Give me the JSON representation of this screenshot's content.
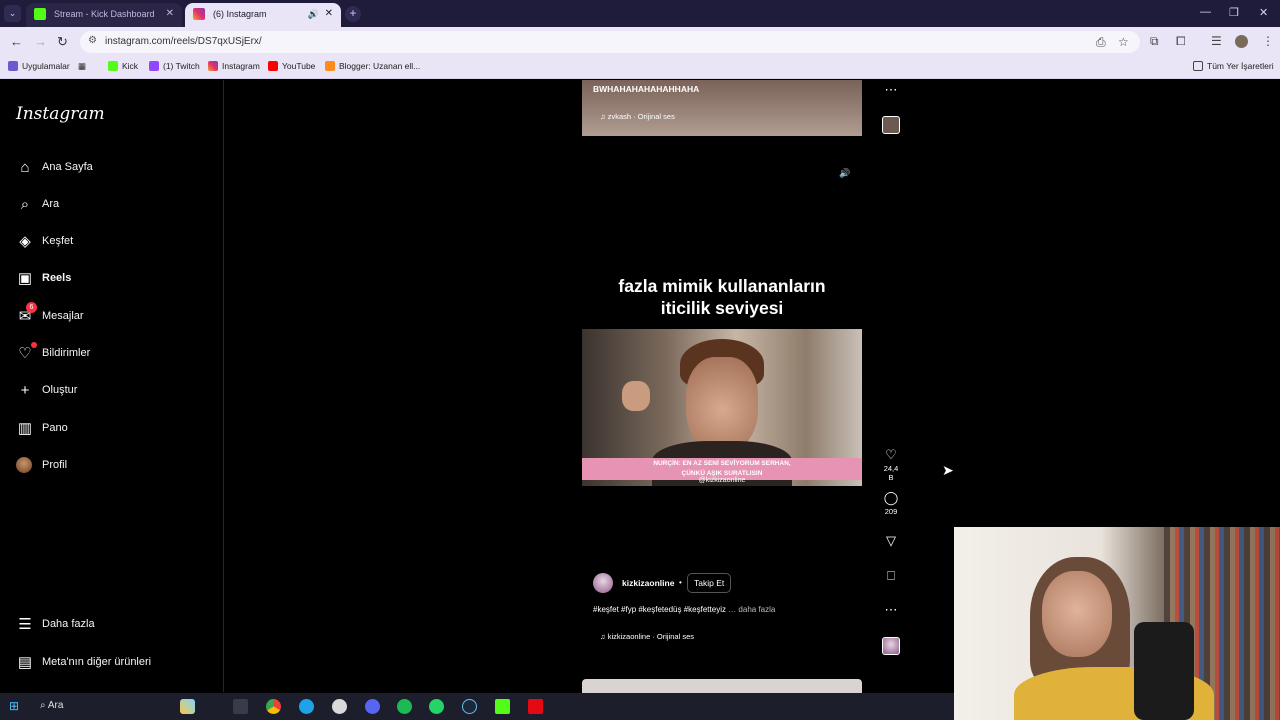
{
  "browser": {
    "tabs": [
      {
        "title": "Stream - Kick Dashboard",
        "active": false
      },
      {
        "title": "(6) Instagram",
        "active": true
      }
    ],
    "url": "instagram.com/reels/DS7qxUSjErx/",
    "bookmarks": [
      "Uygulamalar",
      "Kick",
      "(1) Twitch",
      "Instagram",
      "YouTube",
      "Blogger: Uzanan ell...",
      "Tüm Yer İşaretleri"
    ]
  },
  "sidebar": {
    "logo": "Instagram",
    "items": [
      {
        "label": "Ana Sayfa",
        "icon": "home-icon"
      },
      {
        "label": "Ara",
        "icon": "search-icon"
      },
      {
        "label": "Keşfet",
        "icon": "compass-icon"
      },
      {
        "label": "Reels",
        "icon": "reels-icon"
      },
      {
        "label": "Mesajlar",
        "icon": "messenger-icon",
        "badge": "6"
      },
      {
        "label": "Bildirimler",
        "icon": "heart-icon"
      },
      {
        "label": "Oluştur",
        "icon": "plus-icon"
      },
      {
        "label": "Pano",
        "icon": "dashboard-icon"
      },
      {
        "label": "Profil",
        "icon": "avatar"
      }
    ],
    "bottom": [
      {
        "label": "Daha fazla",
        "icon": "menu-icon"
      },
      {
        "label": "Meta'nın diğer ürünleri",
        "icon": "meta-icon"
      }
    ]
  },
  "prev_reel": {
    "caption": "BWHAHAHAHAHAHHAHA",
    "audio": "zvkash · Orijinal ses"
  },
  "reel": {
    "caption_line1": "fazla mimik kullananların",
    "caption_line2": "iticilik seviyesi",
    "subtitle_line1": "NURÇİN: EN AZ SENİ SEVİYORUM SERHAN,",
    "subtitle_line2": "ÇÜNKÜ AŞIK SURATLISIN",
    "watermark": "@kizkizaonline",
    "owner": "kizkizaonline",
    "follow_label": "Takip Et",
    "hashtags": "#keşfet #fyp #keşfetedüş #keşfetteyiz",
    "more_label": "… daha fazla",
    "audio": "kizkizaonline · Orijinal ses",
    "likes": "24,4 B",
    "comments": "209"
  },
  "taskbar": {
    "search_label": "Ara"
  }
}
